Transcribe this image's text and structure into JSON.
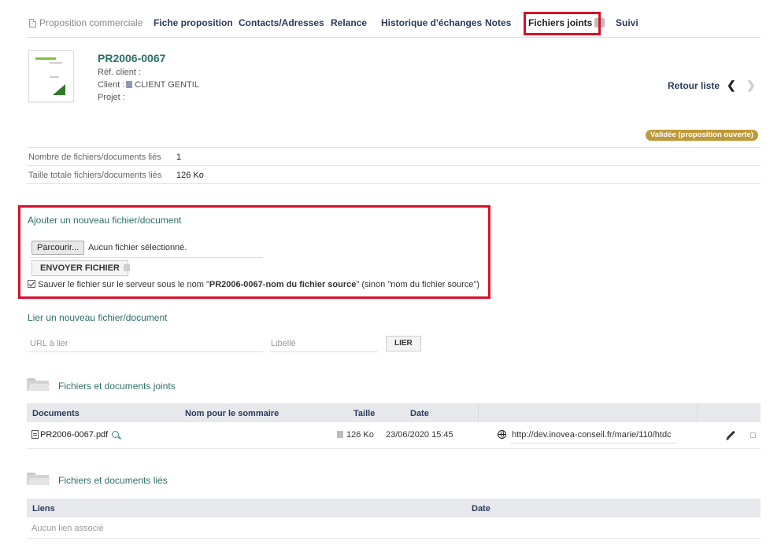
{
  "tabs": [
    {
      "label": "Proposition commerciale"
    },
    {
      "label": "Fiche proposition"
    },
    {
      "label": "Contacts/Adresses"
    },
    {
      "label": "Relance"
    },
    {
      "label": "Historique d'échanges"
    },
    {
      "label": "Notes"
    },
    {
      "label": "Fichiers joints",
      "badge": "1"
    },
    {
      "label": "Suivi"
    }
  ],
  "header": {
    "ref": "PR2006-0067",
    "ref_client_label": "Réf. client :",
    "client_label": "Client :",
    "client_name": "CLIENT GENTIL",
    "projet_label": "Projet :",
    "retour_label": "Retour liste",
    "prev_glyph": "❮",
    "next_glyph": "❯",
    "status": "Validée (proposition ouverte)",
    "status_color": "#bf9a3a"
  },
  "stats": [
    {
      "label": "Nombre de fichiers/documents liés",
      "value": "1"
    },
    {
      "label": "Taille totale fichiers/documents liés",
      "value": "126 Ko"
    }
  ],
  "upload": {
    "title": "Ajouter un nouveau fichier/document",
    "browse_label": "Parcourir...",
    "no_file": "Aucun fichier sélectionné.",
    "send_label": "ENVOYER FICHIER",
    "save_text_before": "Sauver le fichier sur le serveur sous le nom \"",
    "save_text_bold": "PR2006-0067-nom du fichier source",
    "save_text_after": "\" (sinon \"nom du fichier source\")"
  },
  "link": {
    "title": "Lier un nouveau fichier/document",
    "url_placeholder": "URL à lier",
    "label_placeholder": "Libellé",
    "button_label": "LIER"
  },
  "attached": {
    "title": "Fichiers et documents joints",
    "columns": {
      "documents": "Documents",
      "nom": "Nom pour le sommaire",
      "taille": "Taille",
      "date": "Date"
    },
    "rows": [
      {
        "file": "PR2006-0067.pdf",
        "size": "126 Ko",
        "date": "23/06/2020 15:45",
        "url": "http://dev.inovea-conseil.fr/marie/110/htdc"
      }
    ]
  },
  "linked": {
    "title": "Fichiers et documents liés",
    "columns": {
      "liens": "Liens",
      "date": "Date"
    },
    "empty": "Aucun lien associé"
  },
  "colors": {
    "accent": "#2d6f6a",
    "highlight": "#d8102a",
    "nav": "#2b3b5c"
  }
}
